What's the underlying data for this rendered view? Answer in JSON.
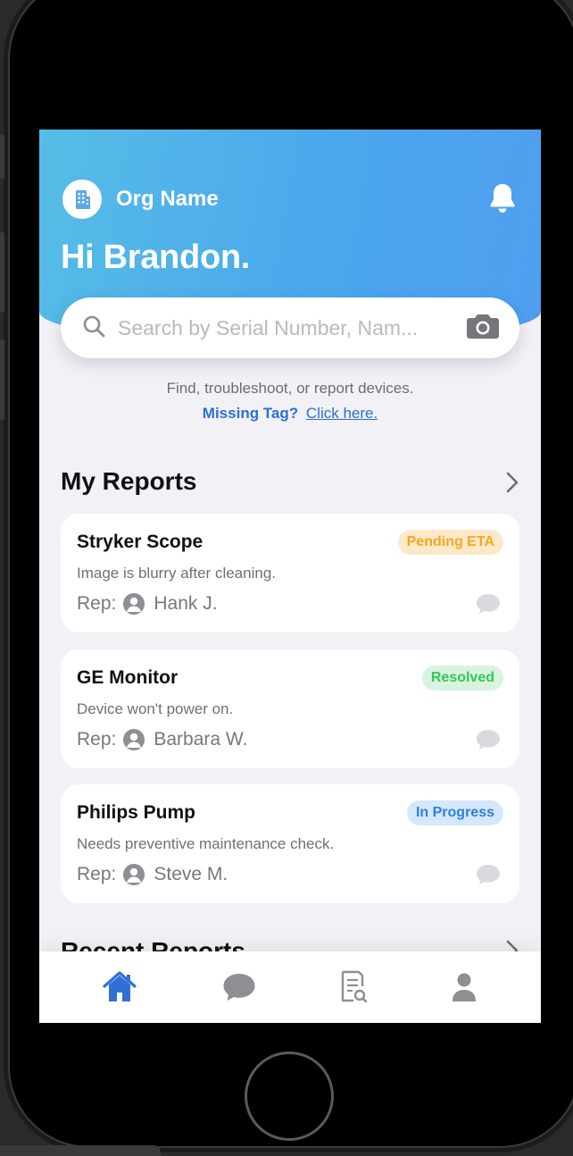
{
  "header": {
    "org_name": "Org Name",
    "greeting": "Hi Brandon.",
    "org_icon": "building-icon",
    "notification_icon": "bell-icon"
  },
  "search": {
    "placeholder": "Search by Serial Number, Nam...",
    "search_icon": "magnifier-icon",
    "camera_icon": "camera-icon"
  },
  "helper": {
    "text": "Find, troubleshoot, or report devices.",
    "missing_label": "Missing Tag?",
    "missing_link": "Click here."
  },
  "my_reports": {
    "title": "My Reports",
    "rep_prefix": "Rep:",
    "items": [
      {
        "title": "Stryker Scope",
        "status": "Pending ETA",
        "status_color": "#f5a623",
        "status_bg": "#fde9c8",
        "description": "Image is blurry after cleaning.",
        "rep": "Hank J."
      },
      {
        "title": "GE Monitor",
        "status": "Resolved",
        "status_color": "#34c759",
        "status_bg": "#d8f3df",
        "description": "Device won't power on.",
        "rep": "Barbara W."
      },
      {
        "title": "Philips Pump",
        "status": "In Progress",
        "status_color": "#2f7fe0",
        "status_bg": "#d4e7fb",
        "description": "Needs preventive maintenance check.",
        "rep": "Steve M."
      }
    ]
  },
  "recent_reports": {
    "title": "Recent Reports"
  },
  "tabbar": {
    "active_color": "#2f6fd6",
    "inactive_color": "#8e8e93",
    "tabs": [
      "home-icon",
      "chat-icon",
      "report-search-icon",
      "profile-icon"
    ]
  }
}
